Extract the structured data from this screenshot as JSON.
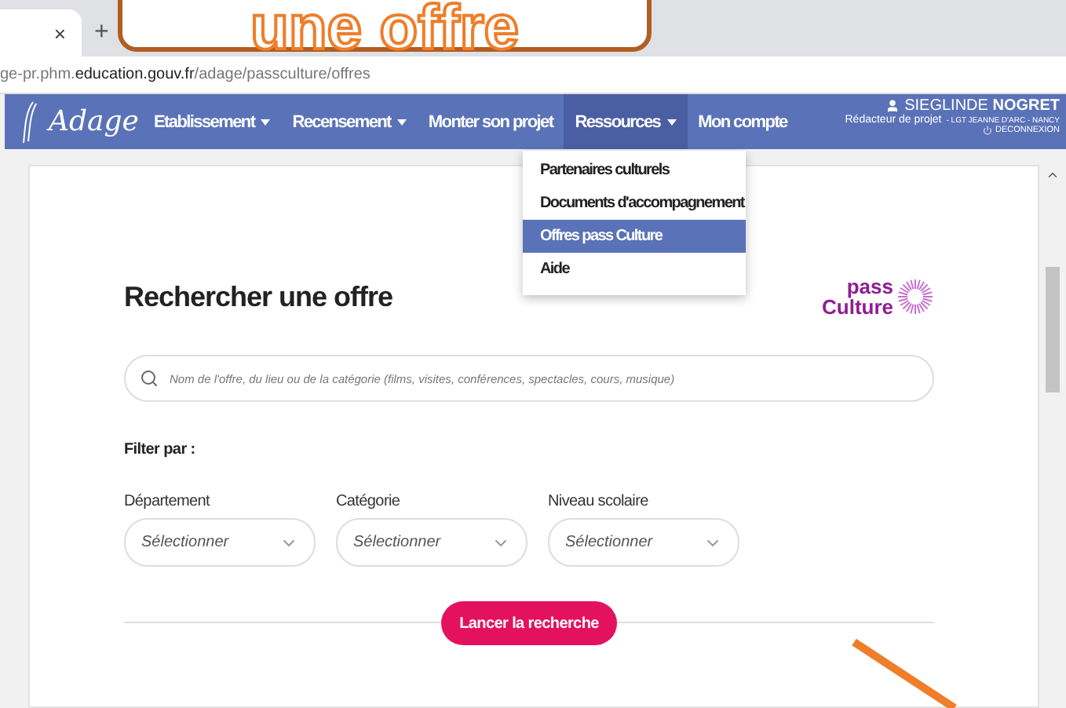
{
  "callout": {
    "text": "une offre"
  },
  "browser": {
    "tab": {
      "close": "×"
    },
    "new_tab": "+",
    "url": "ge-pr.phm.**education.gouv.fr**/adage/passculture/offres"
  },
  "nav": {
    "logo": "Adage",
    "items": [
      {
        "label": "Etablissement",
        "dropdown": true,
        "selected": false
      },
      {
        "label": "Recensement",
        "dropdown": true,
        "selected": false
      },
      {
        "label": "Monter son projet",
        "dropdown": false,
        "selected": false
      },
      {
        "label": "Ressources",
        "dropdown": true,
        "selected": true
      },
      {
        "label": "Mon compte",
        "dropdown": false,
        "selected": false
      }
    ],
    "user": {
      "name": "SIEGLINDE **NOGRET**",
      "role": "Rédacteur de projet",
      "establishment": "- LGT JEANNE D'ARC - NANCY",
      "logout": "DECONNEXION"
    }
  },
  "menu": {
    "items": [
      {
        "label": "Partenaires culturels",
        "selected": false
      },
      {
        "label": "Documents d'accompagnement",
        "selected": false
      },
      {
        "label": "Offres pass Culture",
        "selected": true
      },
      {
        "label": "Aide",
        "selected": false
      }
    ]
  },
  "page": {
    "title": "Rechercher une offre",
    "logo": [
      "pass",
      "Culture"
    ],
    "search": {
      "placeholder": "Nom de l'offre, du lieu ou de la catégorie (films, visites, conférences, spectacles, cours, musique)"
    },
    "filter_label": "Filter par :",
    "filters": [
      {
        "label": "Département",
        "placeholder": "Sélectionner"
      },
      {
        "label": "Catégorie",
        "placeholder": "Sélectionner"
      },
      {
        "label": "Niveau scolaire",
        "placeholder": "Sélectionner"
      }
    ],
    "button": "Lancer la recherche"
  }
}
